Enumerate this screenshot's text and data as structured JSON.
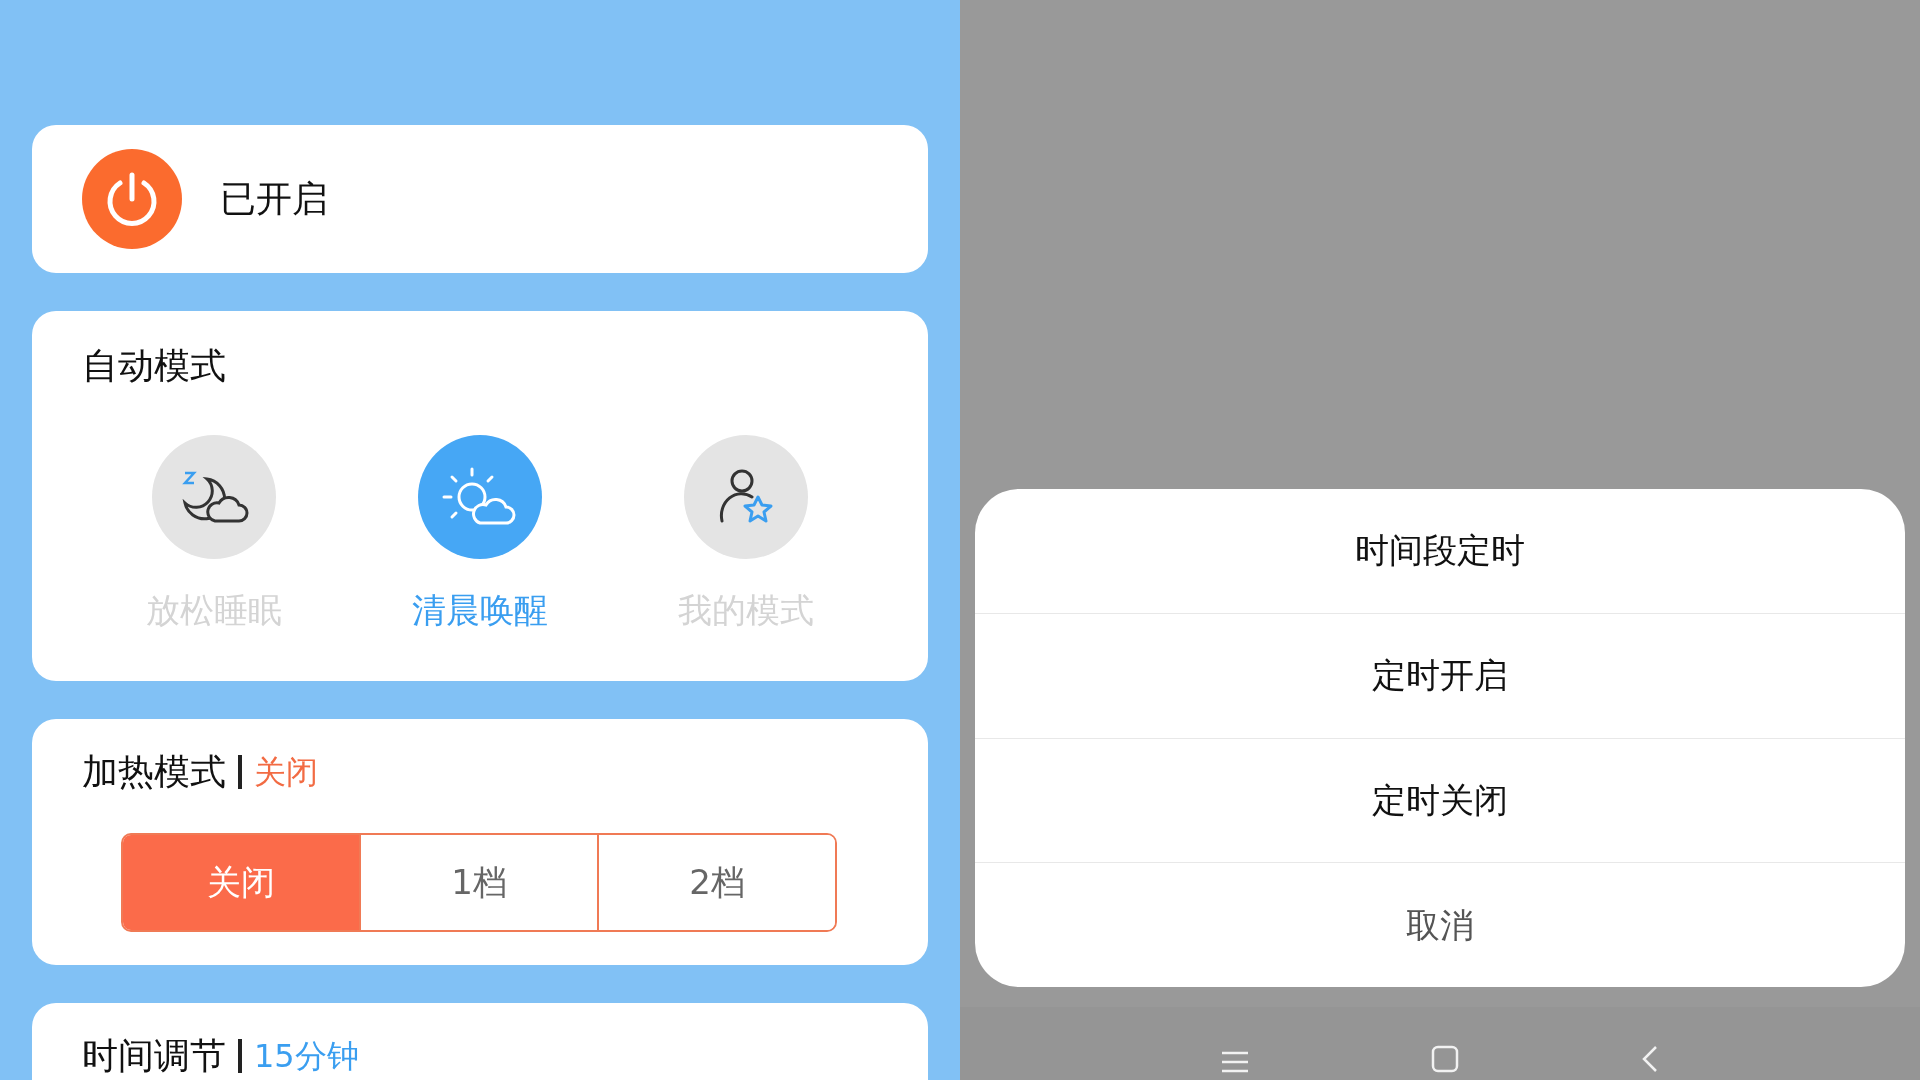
{
  "power": {
    "label": "已开启",
    "on": true
  },
  "auto_mode": {
    "title": "自动模式",
    "modes": [
      {
        "label": "放松睡眠",
        "kind": "sleep",
        "selected": false
      },
      {
        "label": "清晨唤醒",
        "kind": "morning",
        "selected": true
      },
      {
        "label": "我的模式",
        "kind": "custom",
        "selected": false
      }
    ]
  },
  "heating": {
    "title": "加热模式",
    "value": "关闭",
    "options": [
      {
        "label": "关闭",
        "selected": true
      },
      {
        "label": "1档",
        "selected": false
      },
      {
        "label": "2档",
        "selected": false
      }
    ]
  },
  "timer": {
    "title": "时间调节",
    "value": "15分钟"
  },
  "action_sheet": {
    "items": [
      {
        "label": "时间段定时",
        "kind": "option"
      },
      {
        "label": "定时开启",
        "kind": "option"
      },
      {
        "label": "定时关闭",
        "kind": "option"
      },
      {
        "label": "取消",
        "kind": "cancel"
      }
    ]
  }
}
